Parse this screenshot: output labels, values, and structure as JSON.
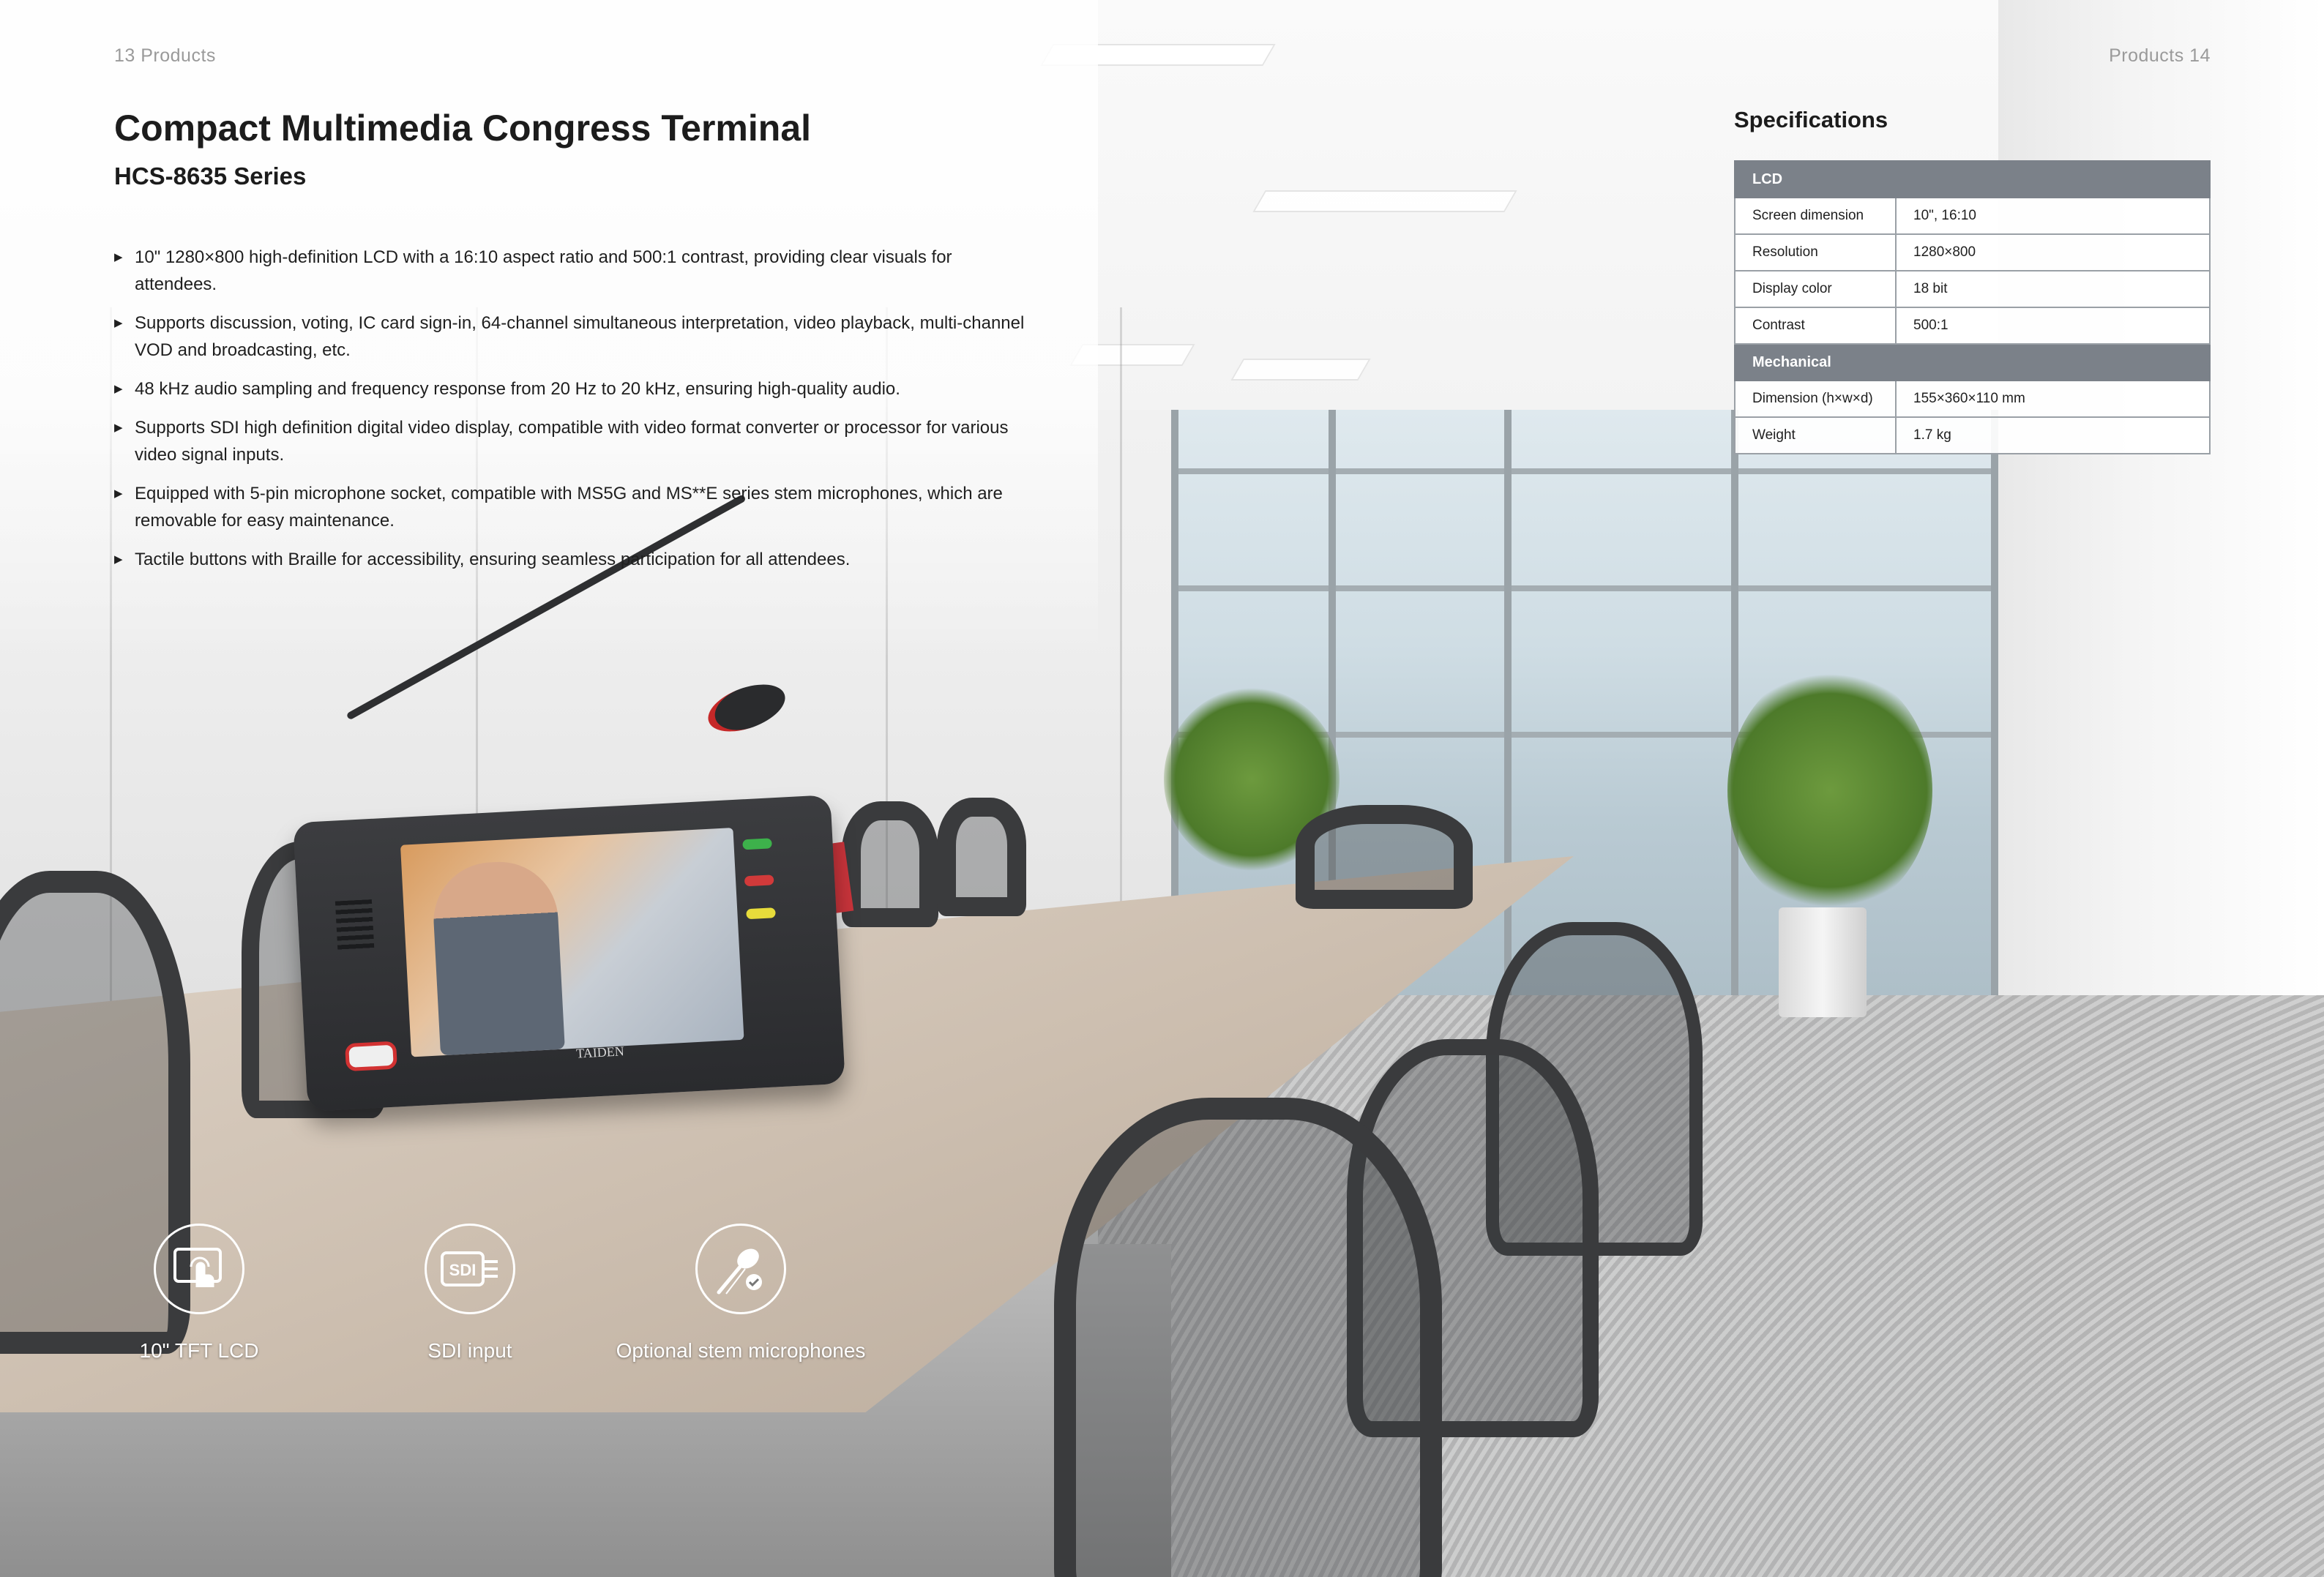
{
  "header": {
    "left_page": "13  Products",
    "right_page": "Products  14"
  },
  "product": {
    "title": "Compact Multimedia Congress Terminal",
    "series": "HCS-8635 Series"
  },
  "features": [
    "10\" 1280×800 high-definition LCD with a 16:10 aspect ratio and 500:1 contrast, providing clear visuals for attendees.",
    "Supports discussion, voting, IC card sign-in, 64-channel simultaneous interpretation, video playback, multi-channel VOD and broadcasting, etc.",
    "48 kHz audio sampling and frequency response from 20 Hz to 20 kHz, ensuring high-quality audio.",
    "Supports SDI high definition digital video display, compatible with video format converter or processor for various video signal inputs.",
    "Equipped with 5-pin microphone socket, compatible with MS5G and MS**E series stem microphones, which are removable for easy maintenance.",
    "Tactile buttons with Braille for accessibility, ensuring seamless participation for all attendees."
  ],
  "specifications": {
    "title": "Specifications",
    "groups": [
      {
        "name": "LCD",
        "rows": [
          {
            "key": "Screen dimension",
            "value": "10\", 16:10"
          },
          {
            "key": "Resolution",
            "value": "1280×800"
          },
          {
            "key": "Display color",
            "value": "18 bit"
          },
          {
            "key": "Contrast",
            "value": "500:1"
          }
        ]
      },
      {
        "name": "Mechanical",
        "rows": [
          {
            "key": "Dimension (h×w×d)",
            "value": "155×360×110 mm"
          },
          {
            "key": "Weight",
            "value": "1.7 kg"
          }
        ]
      }
    ]
  },
  "icons": [
    {
      "name": "touch-screen-icon",
      "label": "10\" TFT LCD"
    },
    {
      "name": "sdi-icon",
      "icon_text": "SDI",
      "label": "SDI input"
    },
    {
      "name": "stem-microphone-icon",
      "label": "Optional stem microphones"
    }
  ],
  "device": {
    "brand": "TAIDEN"
  },
  "colors": {
    "spec_header_bg": "#7b8189",
    "spec_border": "#9aa0a6",
    "accent_red": "#d23232"
  }
}
